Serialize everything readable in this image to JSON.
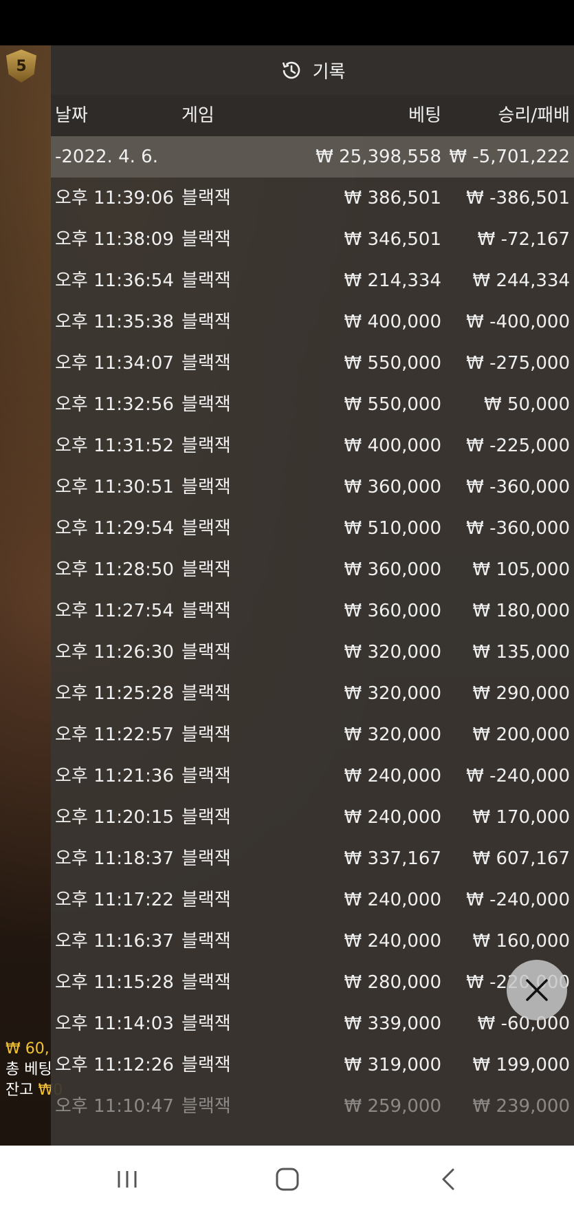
{
  "panel": {
    "title": "기록",
    "title_icon": "history-icon"
  },
  "columns": {
    "date": "날짜",
    "game": "게임",
    "bet": "베팅",
    "result": "승리/패배"
  },
  "summary": {
    "date": "-2022. 4. 6.",
    "bet": "₩ 25,398,558",
    "result": "₩ -5,701,222"
  },
  "rows": [
    {
      "time": "오후 11:39:06",
      "game": "블랙잭",
      "bet": "₩ 386,501",
      "result": "₩ -386,501"
    },
    {
      "time": "오후 11:38:09",
      "game": "블랙잭",
      "bet": "₩ 346,501",
      "result": "₩ -72,167"
    },
    {
      "time": "오후 11:36:54",
      "game": "블랙잭",
      "bet": "₩ 214,334",
      "result": "₩ 244,334"
    },
    {
      "time": "오후 11:35:38",
      "game": "블랙잭",
      "bet": "₩ 400,000",
      "result": "₩ -400,000"
    },
    {
      "time": "오후 11:34:07",
      "game": "블랙잭",
      "bet": "₩ 550,000",
      "result": "₩ -275,000"
    },
    {
      "time": "오후 11:32:56",
      "game": "블랙잭",
      "bet": "₩ 550,000",
      "result": "₩ 50,000"
    },
    {
      "time": "오후 11:31:52",
      "game": "블랙잭",
      "bet": "₩ 400,000",
      "result": "₩ -225,000"
    },
    {
      "time": "오후 11:30:51",
      "game": "블랙잭",
      "bet": "₩ 360,000",
      "result": "₩ -360,000"
    },
    {
      "time": "오후 11:29:54",
      "game": "블랙잭",
      "bet": "₩ 510,000",
      "result": "₩ -360,000"
    },
    {
      "time": "오후 11:28:50",
      "game": "블랙잭",
      "bet": "₩ 360,000",
      "result": "₩ 105,000"
    },
    {
      "time": "오후 11:27:54",
      "game": "블랙잭",
      "bet": "₩ 360,000",
      "result": "₩ 180,000"
    },
    {
      "time": "오후 11:26:30",
      "game": "블랙잭",
      "bet": "₩ 320,000",
      "result": "₩ 135,000"
    },
    {
      "time": "오후 11:25:28",
      "game": "블랙잭",
      "bet": "₩ 320,000",
      "result": "₩ 290,000"
    },
    {
      "time": "오후 11:22:57",
      "game": "블랙잭",
      "bet": "₩ 320,000",
      "result": "₩ 200,000"
    },
    {
      "time": "오후 11:21:36",
      "game": "블랙잭",
      "bet": "₩ 240,000",
      "result": "₩ -240,000"
    },
    {
      "time": "오후 11:20:15",
      "game": "블랙잭",
      "bet": "₩ 240,000",
      "result": "₩ 170,000"
    },
    {
      "time": "오후 11:18:37",
      "game": "블랙잭",
      "bet": "₩ 337,167",
      "result": "₩ 607,167"
    },
    {
      "time": "오후 11:17:22",
      "game": "블랙잭",
      "bet": "₩ 240,000",
      "result": "₩ -240,000"
    },
    {
      "time": "오후 11:16:37",
      "game": "블랙잭",
      "bet": "₩ 240,000",
      "result": "₩ 160,000"
    },
    {
      "time": "오후 11:15:28",
      "game": "블랙잭",
      "bet": "₩ 280,000",
      "result": "₩ -220,000"
    },
    {
      "time": "오후 11:14:03",
      "game": "블랙잭",
      "bet": "₩ 339,000",
      "result": "₩ -60,000"
    },
    {
      "time": "오후 11:12:26",
      "game": "블랙잭",
      "bet": "₩ 319,000",
      "result": "₩ 199,000"
    },
    {
      "time": "오후 11:10:47",
      "game": "블랙잭",
      "bet": "₩ 259,000",
      "result": "₩ 239,000"
    }
  ],
  "background": {
    "level": "5",
    "amount": "₩ 60,",
    "total_bet_label": "총 베팅",
    "balance_label": "잔고",
    "balance_value": "₩0"
  },
  "colors": {
    "panel": "#3a3632",
    "accent_gold": "#f1c232"
  },
  "close_button": {
    "icon": "close-icon"
  },
  "navbar": {
    "recent_icon": "recent-apps-icon",
    "home_icon": "home-icon",
    "back_icon": "back-icon"
  }
}
